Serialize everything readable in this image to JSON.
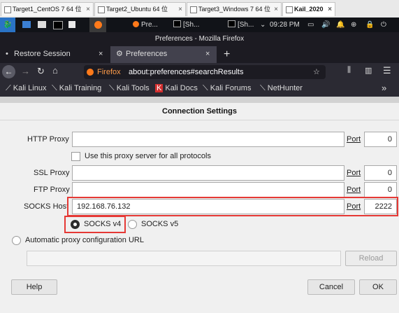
{
  "vm_tabs": [
    {
      "label": "Target1_CentOS 7 64 位"
    },
    {
      "label": "Target2_Ubuntu 64 位"
    },
    {
      "label": "Target3_Windows 7 64 位"
    },
    {
      "label": "Kail_2020"
    }
  ],
  "panel": {
    "task_items": [
      "Pre...",
      "[Sh...",
      "[Sh..."
    ],
    "time": "09:28 PM"
  },
  "window_title": "Preferences - Mozilla Firefox",
  "firefox": {
    "tabs": [
      {
        "label": "Restore Session"
      },
      {
        "label": "Preferences"
      }
    ],
    "url_brand": "Firefox",
    "url": "about:preferences#searchResults",
    "bookmarks": [
      "Kali Linux",
      "Kali Training",
      "Kali Tools",
      "Kali Docs",
      "Kali Forums",
      "NetHunter"
    ]
  },
  "dialog": {
    "title": "Connection Settings",
    "http_proxy_label": "HTTP Proxy",
    "http_proxy_value": "",
    "http_port_label": "Port",
    "http_port_value": "0",
    "use_all_label": "Use this proxy server for all protocols",
    "ssl_proxy_label": "SSL Proxy",
    "ssl_proxy_value": "",
    "ssl_port_label": "Port",
    "ssl_port_value": "0",
    "ftp_proxy_label": "FTP Proxy",
    "ftp_proxy_value": "",
    "ftp_port_label": "Port",
    "ftp_port_value": "0",
    "socks_host_label": "SOCKS Host",
    "socks_host_value": "192.168.76.132",
    "socks_port_label": "Port",
    "socks_port_value": "2222",
    "socks_v4_label": "SOCKS v4",
    "socks_v5_label": "SOCKS v5",
    "auto_config_label": "Automatic proxy configuration URL",
    "auto_config_value": "",
    "reload_label": "Reload",
    "help_label": "Help",
    "cancel_label": "Cancel",
    "ok_label": "OK"
  },
  "colors": {
    "highlight": "#e53935",
    "firefox_dark": "#2b2a33"
  }
}
